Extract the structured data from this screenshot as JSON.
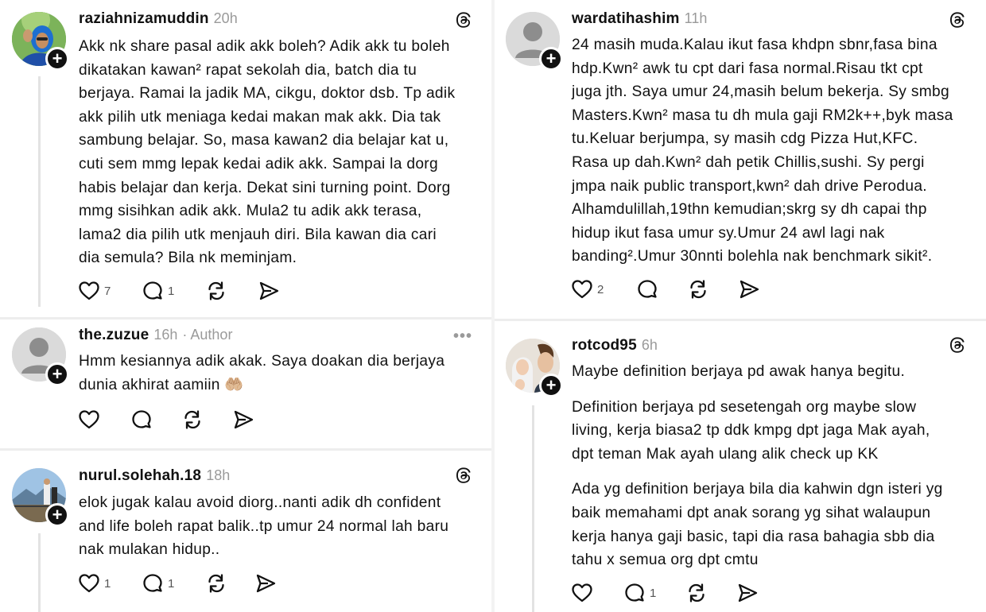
{
  "left": [
    {
      "username": "raziahnizamuddin",
      "time": "20h",
      "lines": [
        "Akk nk share pasal adik akk boleh? Adik akk tu boleh",
        "dikatakan kawan² rapat sekolah dia, batch dia tu",
        "berjaya. Ramai la jadik MA, cikgu, doktor dsb. Tp adik",
        "akk pilih utk meniaga kedai makan mak akk. Dia tak",
        "sambung belajar. So, masa kawan2 dia belajar kat u,",
        "cuti sem mmg lepak kedai adik akk. Sampai la dorg",
        "habis belajar dan kerja. Dekat sini turning point. Dorg",
        "mmg sisihkan adik akk. Mula2 tu adik akk terasa,",
        "lama2 dia pilih utk menjauh diri. Bila kawan dia cari",
        "dia semula? Bila nk meminjam."
      ],
      "likes": "7",
      "replies": "1"
    },
    {
      "username": "the.zuzue",
      "time": "16h",
      "author_tag": "· Author",
      "more": "•••",
      "lines": [
        "Hmm kesiannya adik akak. Saya doakan dia berjaya",
        "dunia akhirat aamiin 🤲🏼"
      ],
      "likes": "",
      "replies": ""
    },
    {
      "username": "nurul.solehah.18",
      "time": "18h",
      "lines": [
        "elok jugak kalau avoid diorg..nanti adik dh confident",
        "and life boleh rapat balik..tp umur 24 normal lah baru",
        "nak mulakan hidup.."
      ],
      "likes": "1",
      "replies": "1"
    }
  ],
  "right": [
    {
      "username": "wardatihashim",
      "time": "11h",
      "lines": [
        "24 masih muda.Kalau ikut fasa khdpn sbnr,fasa bina",
        "hdp.Kwn² awk tu cpt dari fasa normal.Risau tkt cpt",
        "juga jth. Saya umur 24,masih belum bekerja. Sy smbg",
        "Masters.Kwn² masa tu dh mula gaji RM2k++,byk masa",
        "tu.Keluar berjumpa, sy masih cdg Pizza Hut,KFC.",
        "Rasa up dah.Kwn² dah petik Chillis,sushi. Sy pergi",
        "jmpa naik public transport,kwn² dah drive Perodua.",
        "Alhamdulillah,19thn kemudian;skrg sy dh capai thp",
        "hidup ikut fasa umur sy.Umur 24 awl lagi nak",
        "banding².Umur 30nnti bolehla nak benchmark sikit²."
      ],
      "likes": "2",
      "replies": ""
    },
    {
      "username": "rotcod95",
      "time": "6h",
      "paragraphs": [
        [
          "Maybe definition berjaya pd awak hanya begitu."
        ],
        [
          "Definition berjaya pd sesetengah org maybe slow",
          "living, kerja biasa2 tp ddk kmpg dpt jaga Mak ayah,",
          "dpt teman Mak ayah ulang alik check up KK"
        ],
        [
          "Ada yg definition berjaya bila dia kahwin dgn isteri yg",
          "baik memahami dpt anak sorang yg sihat walaupun",
          "kerja hanya gaji basic, tapi dia rasa bahagia sbb dia",
          "tahu x semua org dpt cmtu"
        ]
      ],
      "likes": "",
      "replies": "1"
    }
  ],
  "icons": {
    "like": "heart-icon",
    "reply": "comment-icon",
    "repost": "repost-icon",
    "share": "send-icon",
    "brand": "threads-logo-icon",
    "follow": "plus-icon"
  },
  "colors": {
    "text": "#111111",
    "muted": "#9a9a9a",
    "divider": "#ededed"
  }
}
